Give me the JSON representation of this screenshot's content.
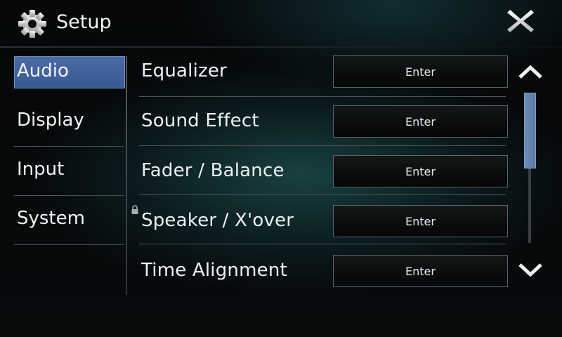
{
  "header": {
    "title": "Setup",
    "icon": "gear-icon",
    "close_icon": "close-icon"
  },
  "sidebar": {
    "items": [
      {
        "label": "Audio",
        "active": true
      },
      {
        "label": "Display",
        "active": false
      },
      {
        "label": "Input",
        "active": false
      },
      {
        "label": "System",
        "active": false
      }
    ]
  },
  "main": {
    "rows": [
      {
        "label": "Equalizer",
        "button": "Enter"
      },
      {
        "label": "Sound Effect",
        "button": "Enter"
      },
      {
        "label": "Fader / Balance",
        "button": "Enter"
      },
      {
        "label": "Speaker / X'over",
        "button": "Enter",
        "locked": true
      },
      {
        "label": "Time Alignment",
        "button": "Enter"
      }
    ]
  },
  "scrollbar": {
    "up_icon": "chevron-up-icon",
    "down_icon": "chevron-down-icon"
  },
  "colors": {
    "active_tab": "#3f5f9b",
    "scroll_thumb": "#6384ad"
  }
}
